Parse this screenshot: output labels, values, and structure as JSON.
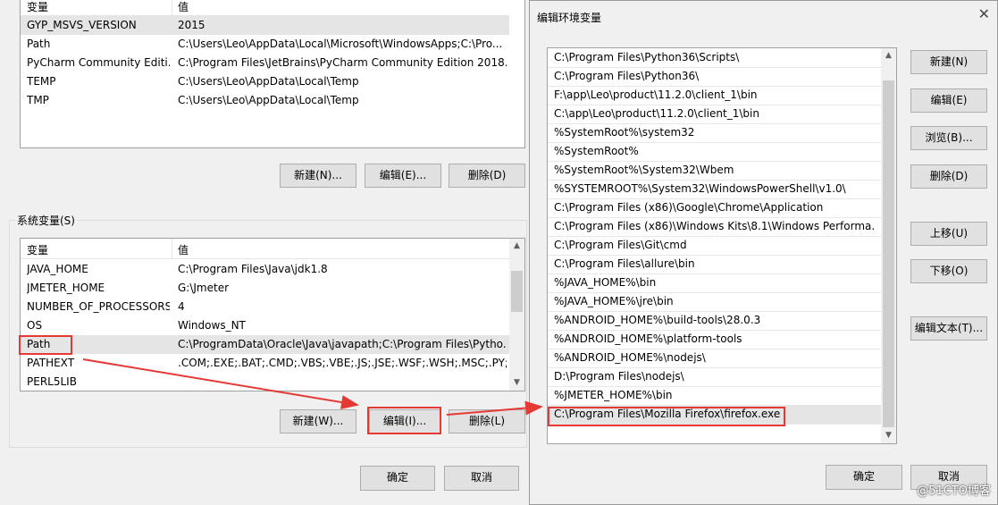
{
  "user_vars": {
    "headers": [
      "变量",
      "值"
    ],
    "rows": [
      [
        "GYP_MSVS_VERSION",
        "2015"
      ],
      [
        "Path",
        "C:\\Users\\Leo\\AppData\\Local\\Microsoft\\WindowsApps;C:\\Pro..."
      ],
      [
        "PyCharm Community Editi...",
        "C:\\Program Files\\JetBrains\\PyCharm Community Edition 2018...."
      ],
      [
        "TEMP",
        "C:\\Users\\Leo\\AppData\\Local\\Temp"
      ],
      [
        "TMP",
        "C:\\Users\\Leo\\AppData\\Local\\Temp"
      ]
    ],
    "buttons": {
      "new": "新建(N)...",
      "edit": "编辑(E)...",
      "delete": "删除(D)"
    }
  },
  "system_vars": {
    "label": "系统变量(S)",
    "headers": [
      "变量",
      "值"
    ],
    "rows": [
      [
        "JAVA_HOME",
        "C:\\Program Files\\Java\\jdk1.8"
      ],
      [
        "JMETER_HOME",
        "G:\\Jmeter"
      ],
      [
        "NUMBER_OF_PROCESSORS",
        "4"
      ],
      [
        "OS",
        "Windows_NT"
      ],
      [
        "Path",
        "C:\\ProgramData\\Oracle\\Java\\javapath;C:\\Program Files\\Pytho..."
      ],
      [
        "PATHEXT",
        ".COM;.EXE;.BAT;.CMD;.VBS;.VBE;.JS;.JSE;.WSF;.WSH;.MSC;.PY;.P..."
      ],
      [
        "PERL5LIB",
        ""
      ]
    ],
    "buttons": {
      "new": "新建(W)...",
      "edit": "编辑(I)...",
      "delete": "删除(L)"
    }
  },
  "footer": {
    "ok": "确定",
    "cancel": "取消"
  },
  "edit_dialog": {
    "title": "编辑环境变量",
    "paths": [
      "C:\\Program Files\\Python36\\Scripts\\",
      "C:\\Program Files\\Python36\\",
      "F:\\app\\Leo\\product\\11.2.0\\client_1\\bin",
      "C:\\app\\Leo\\product\\11.2.0\\client_1\\bin",
      "%SystemRoot%\\system32",
      "%SystemRoot%",
      "%SystemRoot%\\System32\\Wbem",
      "%SYSTEMROOT%\\System32\\WindowsPowerShell\\v1.0\\",
      "C:\\Program Files (x86)\\Google\\Chrome\\Application",
      "C:\\Program Files (x86)\\Windows Kits\\8.1\\Windows Performa...",
      "C:\\Program Files\\Git\\cmd",
      "C:\\Program Files\\allure\\bin",
      "%JAVA_HOME%\\bin",
      "%JAVA_HOME%\\jre\\bin",
      "%ANDROID_HOME%\\build-tools\\28.0.3",
      "%ANDROID_HOME%\\platform-tools",
      "%ANDROID_HOME%\\nodejs\\",
      "D:\\Program Files\\nodejs\\",
      "%JMETER_HOME%\\bin",
      "C:\\Program Files\\Mozilla Firefox\\firefox.exe"
    ],
    "buttons": {
      "new": "新建(N)",
      "edit": "编辑(E)",
      "browse": "浏览(B)...",
      "delete": "删除(D)",
      "move_up": "上移(U)",
      "move_down": "下移(O)",
      "edit_text": "编辑文本(T)...",
      "ok": "确定",
      "cancel": "取消"
    }
  },
  "watermark": "@51CTO博客",
  "colors": {
    "highlight": "#e53935",
    "selected_row": "#e5e5e5",
    "panel_bg": "#f0f0f0"
  }
}
